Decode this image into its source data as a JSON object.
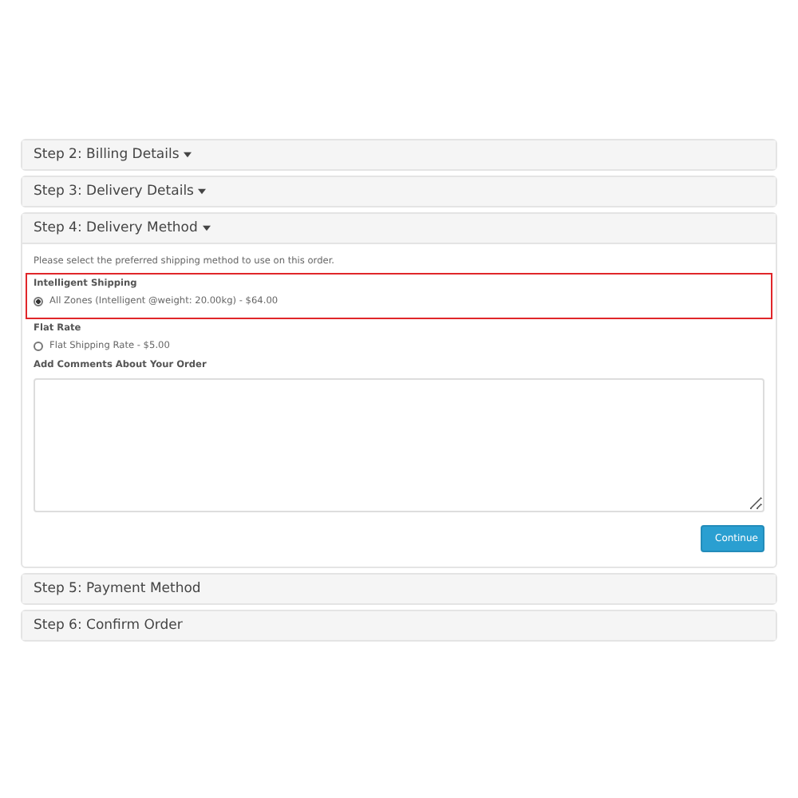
{
  "steps": [
    {
      "title": "Step 2: Billing Details",
      "caret": true
    },
    {
      "title": "Step 3: Delivery Details",
      "caret": true
    },
    {
      "title": "Step 4: Delivery Method",
      "caret": true,
      "body": {
        "intro": "Please select the preferred shipping method to use on this order.",
        "shipping_groups": [
          {
            "title": "Intelligent Shipping",
            "highlighted": true,
            "options": [
              {
                "label": "All Zones (Intelligent @weight: 20.00kg) - $64.00",
                "selected": true
              }
            ]
          },
          {
            "title": "Flat Rate",
            "highlighted": false,
            "options": [
              {
                "label": "Flat Shipping Rate - $5.00",
                "selected": false
              }
            ]
          }
        ],
        "comments_label": "Add Comments About Your Order",
        "button": "Continue"
      }
    },
    {
      "title": "Step 5: Payment Method",
      "caret": false
    },
    {
      "title": "Step 6: Confirm Order",
      "caret": false
    }
  ]
}
